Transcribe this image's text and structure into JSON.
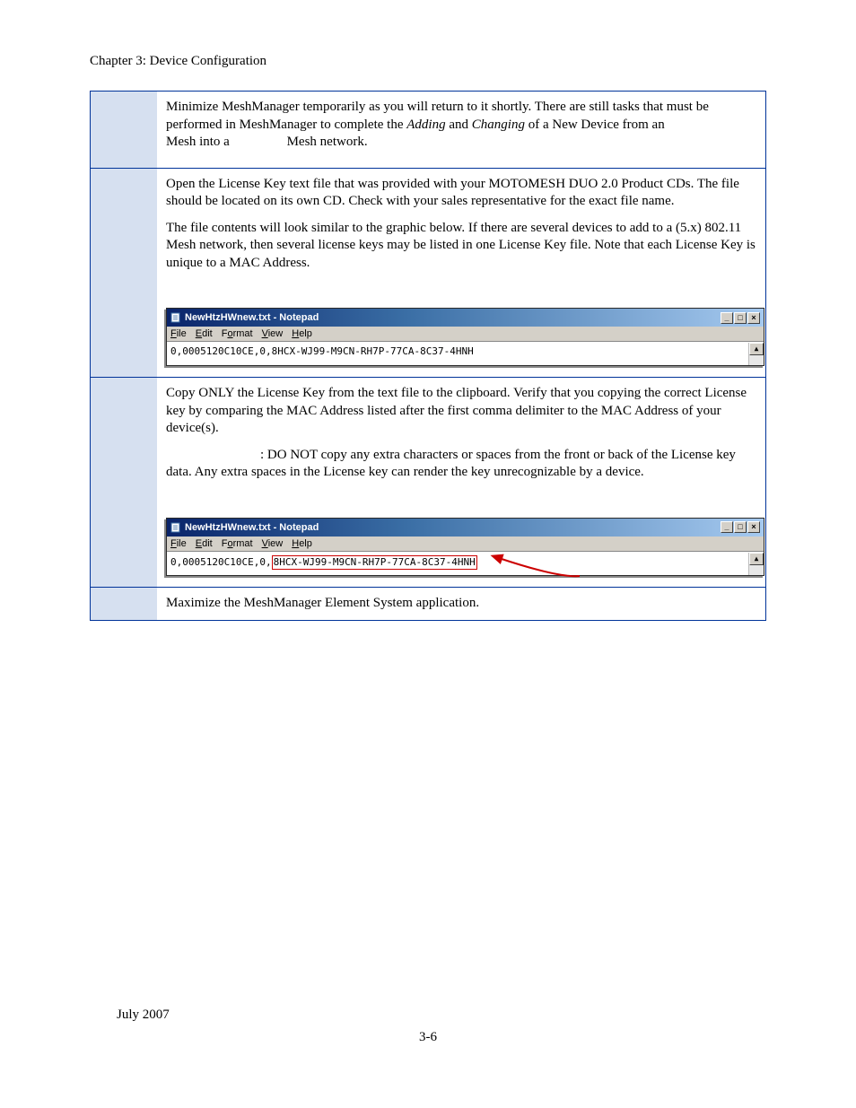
{
  "chapter_header": "Chapter 3: Device Configuration",
  "rows": {
    "r1": {
      "p1a": "Minimize MeshManager temporarily as you will return to it shortly. There are still tasks that must be performed in MeshManager to complete the ",
      "p1b": "Adding",
      "p1c": " and ",
      "p1d": "Changing",
      "p1e": " of a New Device from an ",
      "p1f": "Mesh into a ",
      "p1g": "Mesh network."
    },
    "r2": {
      "p1": "Open the License Key text file that was provided with your MOTOMESH DUO 2.0 Product CDs. The file should be located on its own CD. Check with your sales representative for the exact file name.",
      "p2": "The file contents will look similar to the graphic below.  If there are several devices to add to a (5.x) 802.11    Mesh network, then several license keys may be listed in one License Key file. Note that each License Key is unique to a MAC Address."
    },
    "r3": {
      "p1": "Copy ONLY the License Key from the text file to the clipboard. Verify that you copying the correct License key by comparing the MAC Address listed after the first comma delimiter to the MAC Address of your device(s).",
      "p2a": ": DO NOT copy any extra characters or spaces from the front or back of the License key data. Any extra spaces in the License key can render the key unrecognizable by a device."
    },
    "r4": {
      "p1": "Maximize the MeshManager Element System application."
    }
  },
  "notepad": {
    "title": "NewHtzHWnew.txt - Notepad",
    "menu": {
      "file": "File",
      "edit": "Edit",
      "format": "Format",
      "view": "View",
      "help": "Help"
    },
    "content_full": "0,0005120C10CE,0,8HCX-WJ99-M9CN-RH7P-77CA-8C37-4HNH",
    "content_prefix": "0,0005120C10CE,0,",
    "content_key": "8HCX-WJ99-M9CN-RH7P-77CA-8C37-4HNH"
  },
  "footer": {
    "date": "July 2007",
    "page": "3-6"
  }
}
